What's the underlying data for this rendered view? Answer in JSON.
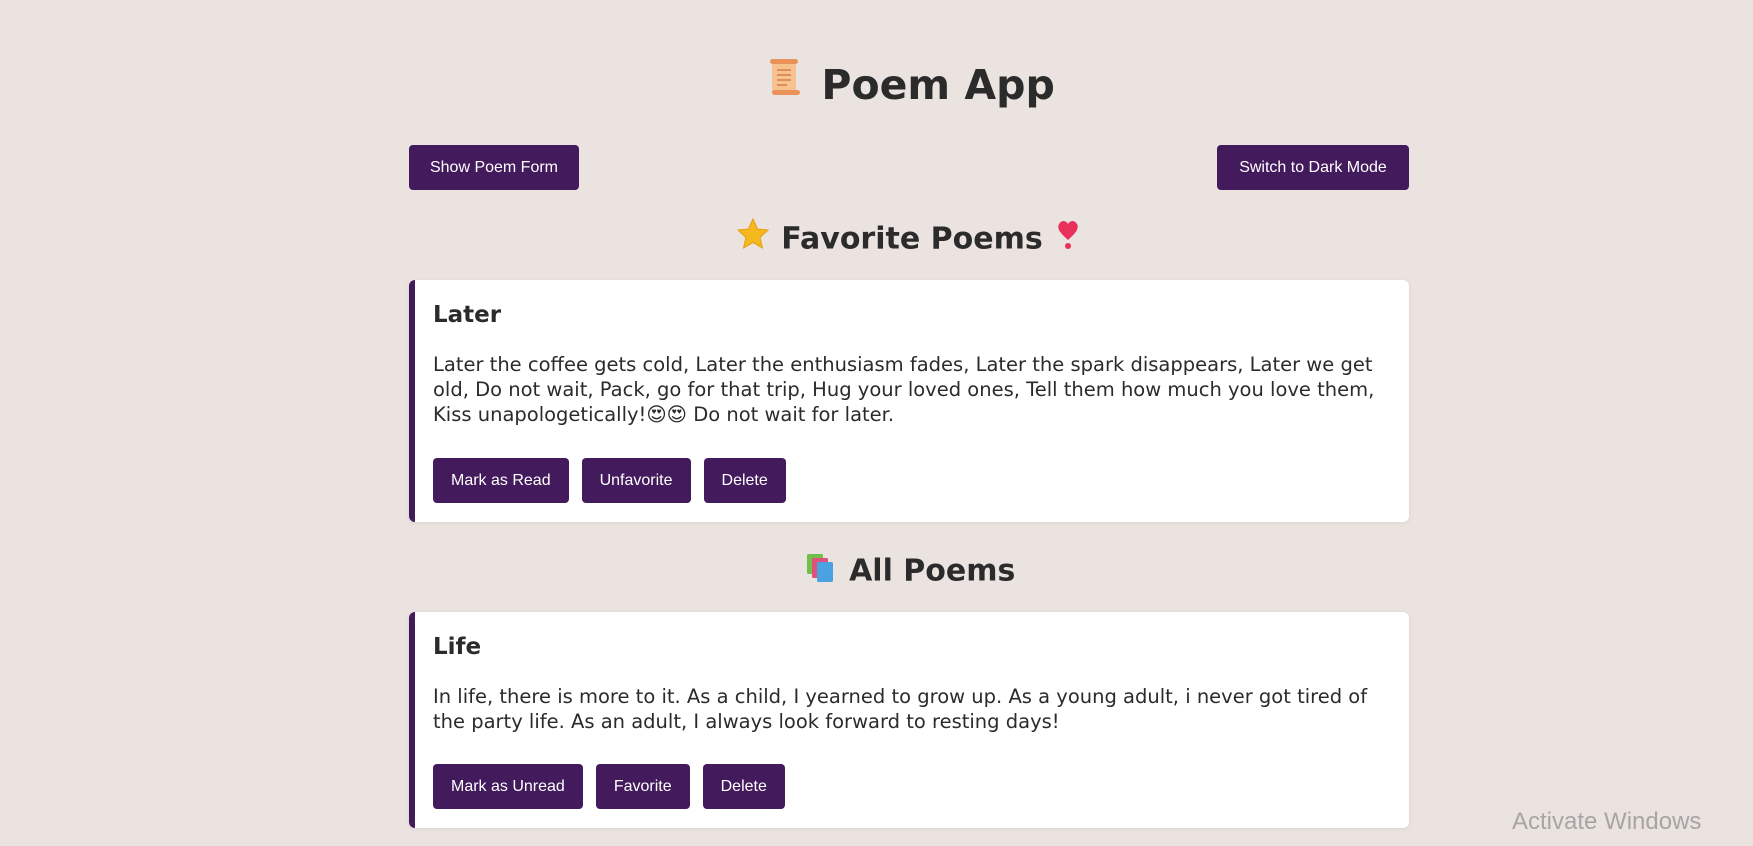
{
  "header": {
    "app_title": "Poem App",
    "title_icon": "scroll-icon"
  },
  "toolbar": {
    "show_form_label": "Show Poem Form",
    "dark_mode_label": "Switch to Dark Mode"
  },
  "favorites": {
    "title": "Favorite Poems",
    "title_icons": [
      "star-icon",
      "heart-exclamation-icon"
    ],
    "poems": [
      {
        "title": "Later",
        "body": "Later the coffee gets cold, Later the enthusiasm fades, Later the spark disappears, Later we get old, Do not wait, Pack, go for that trip, Hug your loved ones, Tell them how much you love them, Kiss unapologetically!😍😍 Do not wait for later.",
        "actions": [
          "Mark as Read",
          "Unfavorite",
          "Delete"
        ]
      }
    ]
  },
  "all_poems": {
    "title": "All Poems",
    "title_icon": "books-icon",
    "poems": [
      {
        "title": "Life",
        "body": "In life, there is more to it. As a child, I yearned to grow up. As a young adult, i never got tired of the party life. As an adult, I always look forward to resting days!",
        "actions": [
          "Mark as Unread",
          "Favorite",
          "Delete"
        ]
      }
    ]
  },
  "system": {
    "watermark": "Activate Windows"
  },
  "colors": {
    "background": "#ebe3df",
    "accent": "#431a5c",
    "card": "#ffffff",
    "text": "#2b2b2b"
  }
}
